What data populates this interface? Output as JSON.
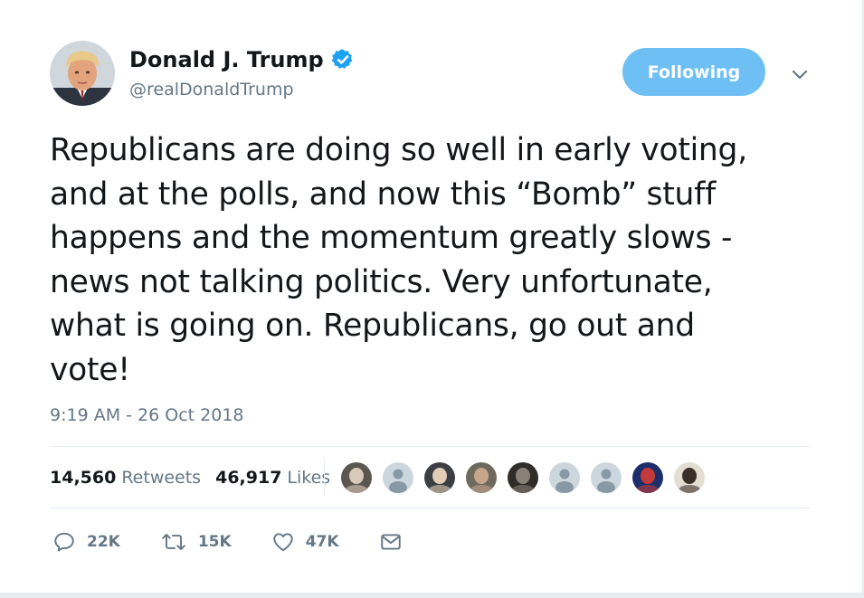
{
  "user": {
    "display_name": "Donald J. Trump",
    "screen_name": "@realDonaldTrump",
    "verified_icon": "verified-badge-icon",
    "avatar_icon": "profile-avatar"
  },
  "follow_button": {
    "label": "Following",
    "color": "#6ec0f4"
  },
  "menu_icon": "chevron-down-icon",
  "tweet": {
    "lines": [
      "Republicans are doing so well in early voting,",
      "and at the polls, and now this “Bomb” stuff",
      "happens and the momentum greatly slows -",
      "news not talking politics. Very unfortunate,",
      "what is going on. Republicans, go out and",
      "vote!"
    ],
    "timestamp": "9:19 AM - 26 Oct 2018"
  },
  "stats": {
    "retweets_count": "14,560",
    "retweets_label": "Retweets",
    "likes_count": "46,917",
    "likes_label": "Likes"
  },
  "likers": [
    {
      "kind": "photo",
      "bg": "#5b5650",
      "fg": "#d8c9b8"
    },
    {
      "kind": "default",
      "bg": "#ccd6dd",
      "fg": "#8899a6"
    },
    {
      "kind": "photo",
      "bg": "#3c3f44",
      "fg": "#e2cdb7"
    },
    {
      "kind": "photo",
      "bg": "#6f6a5f",
      "fg": "#c6a58a"
    },
    {
      "kind": "photo",
      "bg": "#2f2c29",
      "fg": "#8a8178"
    },
    {
      "kind": "default",
      "bg": "#ccd6dd",
      "fg": "#8899a6"
    },
    {
      "kind": "default",
      "bg": "#ccd6dd",
      "fg": "#8899a6"
    },
    {
      "kind": "photo",
      "bg": "#1d2f6a",
      "fg": "#c23a3a"
    },
    {
      "kind": "photo",
      "bg": "#e4ddd2",
      "fg": "#3a2f28"
    }
  ],
  "actions": [
    {
      "name": "reply",
      "icon": "reply-icon",
      "count": "22K"
    },
    {
      "name": "retweet",
      "icon": "retweet-icon",
      "count": "15K"
    },
    {
      "name": "like",
      "icon": "heart-icon",
      "count": "47K"
    },
    {
      "name": "message",
      "icon": "envelope-icon",
      "count": ""
    }
  ],
  "colors": {
    "text": "#14171a",
    "secondary": "#657786",
    "accent": "#1da1f2",
    "border": "#e6ecf0"
  }
}
